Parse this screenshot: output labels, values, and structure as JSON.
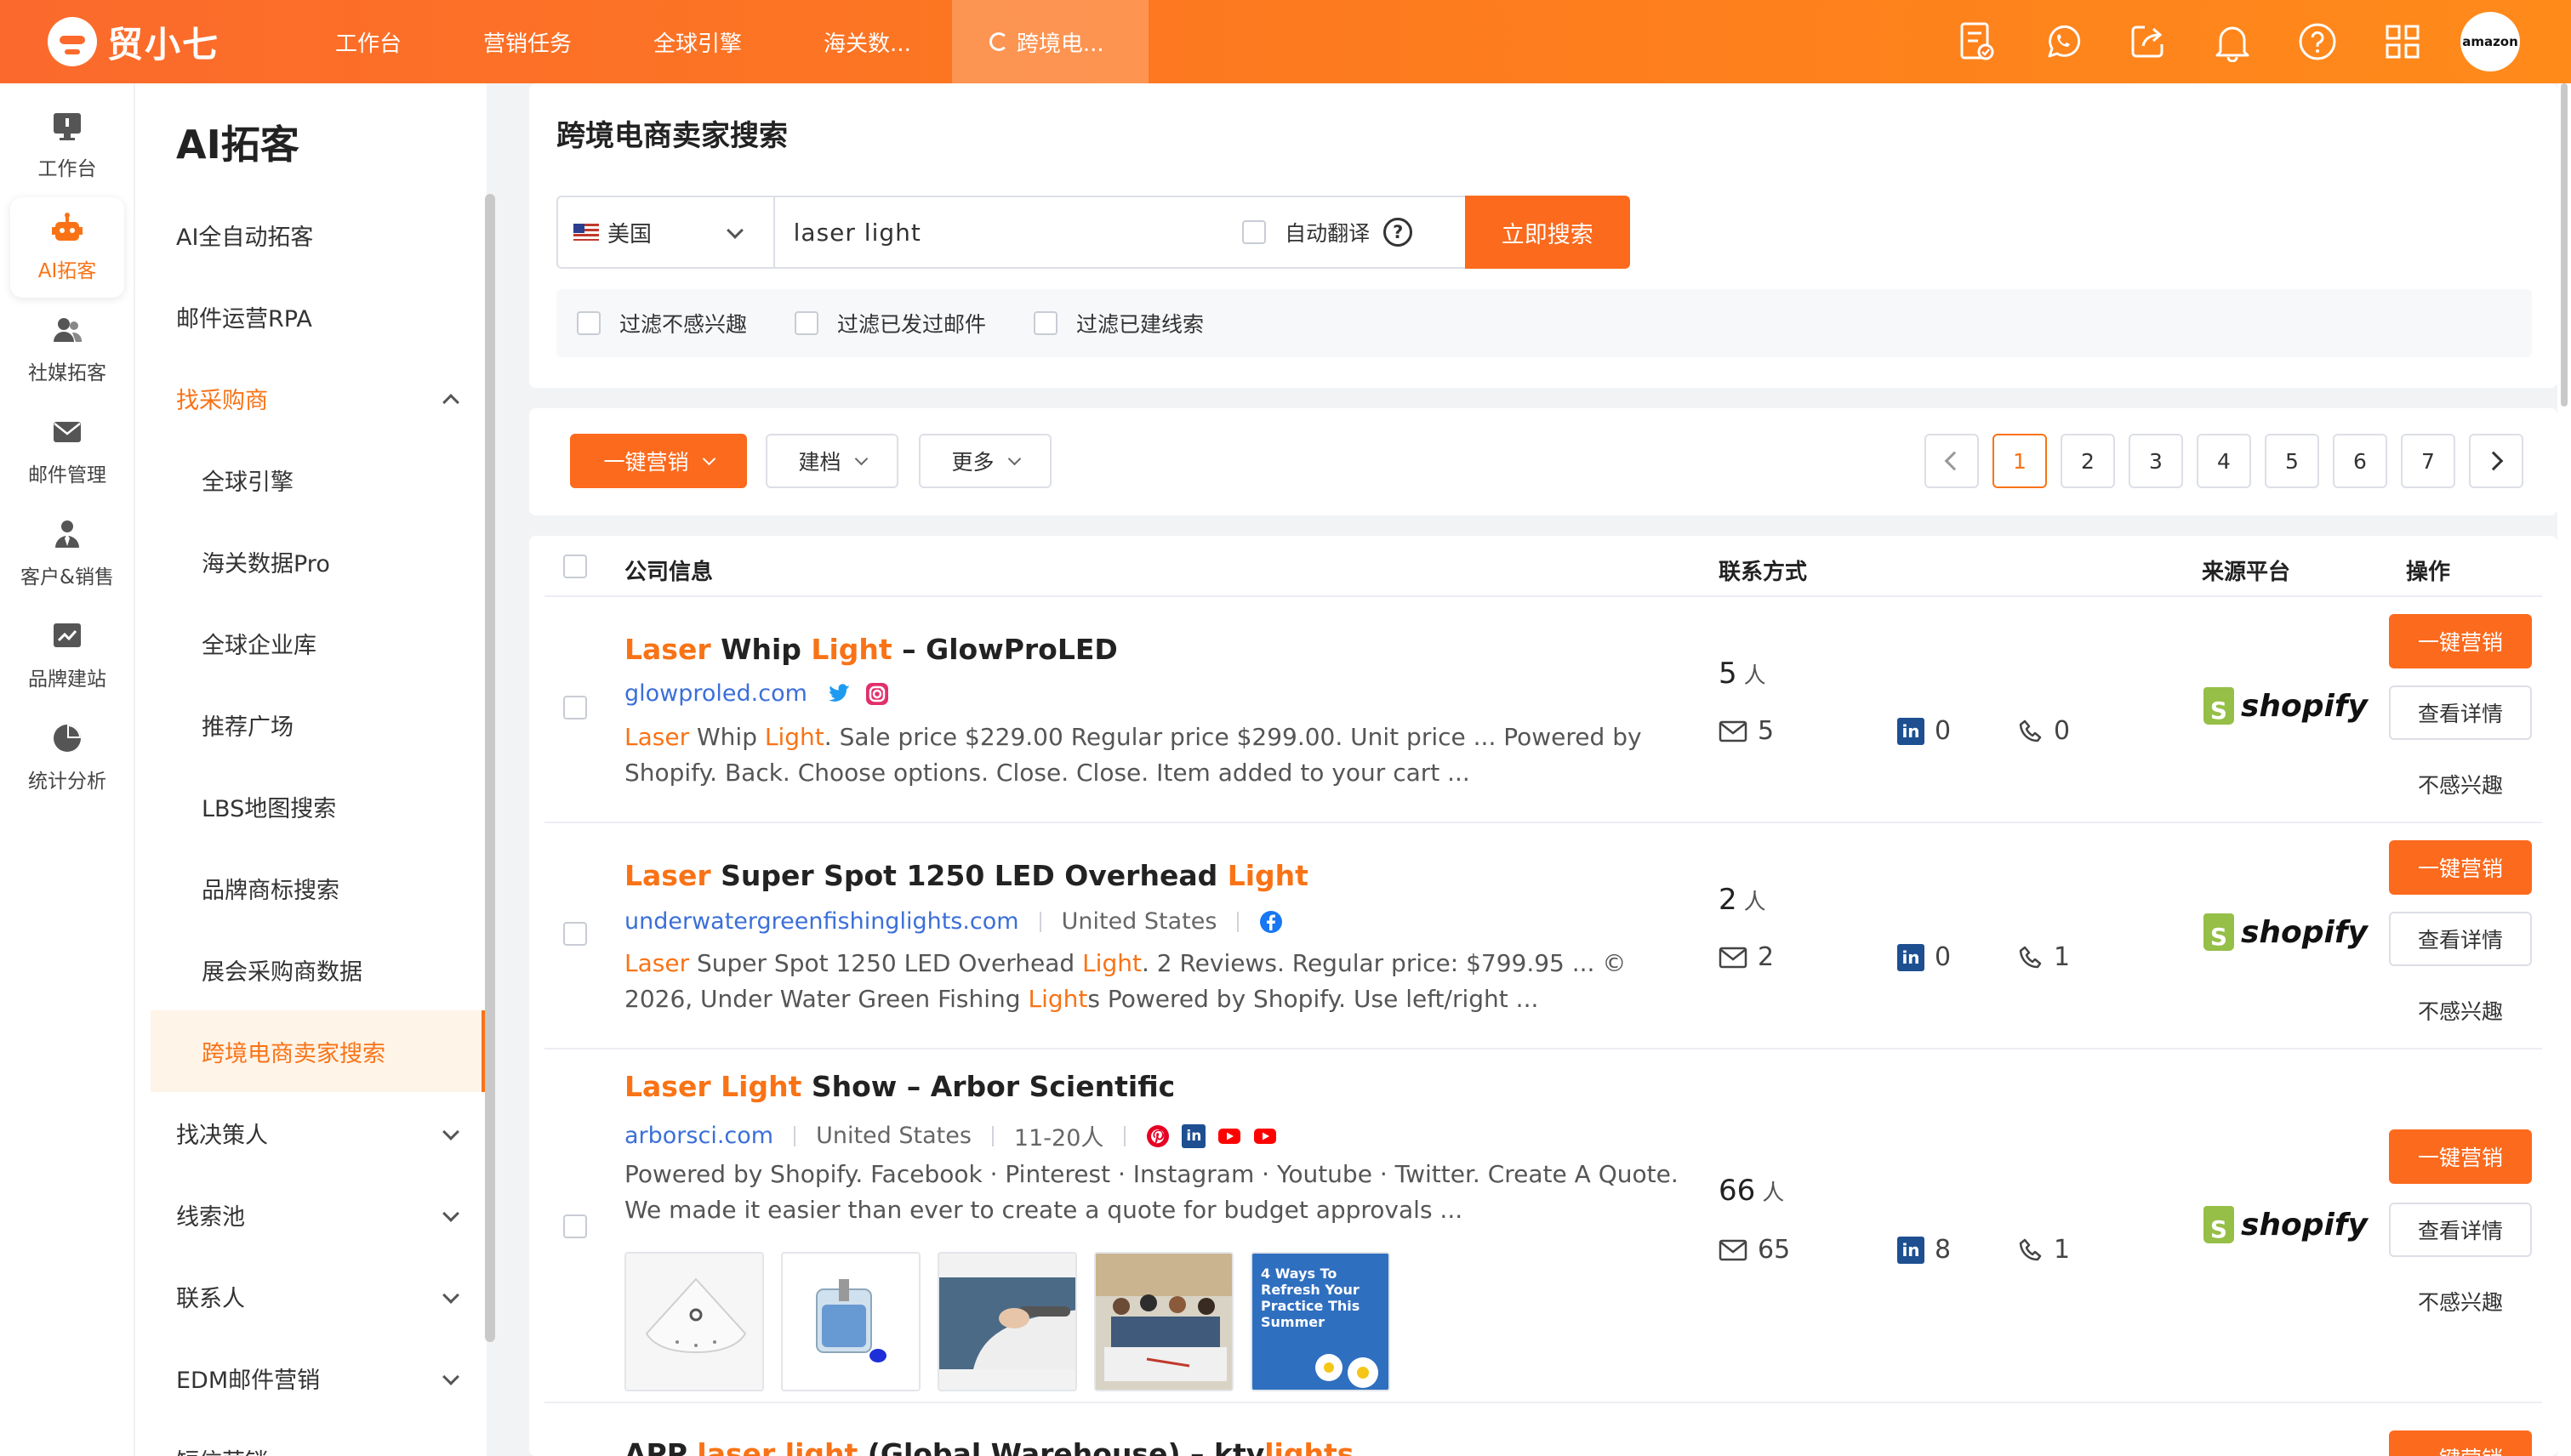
{
  "app": {
    "name": "贸小七"
  },
  "nav_tabs": [
    {
      "label": "工作台"
    },
    {
      "label": "营销任务"
    },
    {
      "label": "全球引擎"
    },
    {
      "label": "海关数..."
    },
    {
      "label": "跨境电..."
    }
  ],
  "top_icons": [
    "report-icon",
    "whatsapp-icon",
    "share-icon",
    "bell-icon",
    "help-icon",
    "apps-grid-icon"
  ],
  "top_badge": "amazon",
  "rail": [
    {
      "label": "工作台",
      "icon": "monitor-icon"
    },
    {
      "label": "AI拓客",
      "icon": "robot-icon"
    },
    {
      "label": "社媒拓客",
      "icon": "users-icon"
    },
    {
      "label": "邮件管理",
      "icon": "mail-icon"
    },
    {
      "label": "客户&销售",
      "icon": "person-icon"
    },
    {
      "label": "品牌建站",
      "icon": "chart-line-icon"
    },
    {
      "label": "统计分析",
      "icon": "pie-icon"
    }
  ],
  "menu": {
    "title": "AI拓客",
    "items": [
      {
        "label": "AI全自动拓客"
      },
      {
        "label": "邮件运营RPA"
      },
      {
        "label": "找采购商"
      },
      {
        "label": "全球引擎"
      },
      {
        "label": "海关数据Pro"
      },
      {
        "label": "全球企业库"
      },
      {
        "label": "推荐广场"
      },
      {
        "label": "LBS地图搜索"
      },
      {
        "label": "品牌商标搜索"
      },
      {
        "label": "展会采购商数据"
      },
      {
        "label": "跨境电商卖家搜索"
      },
      {
        "label": "找决策人"
      },
      {
        "label": "线索池"
      },
      {
        "label": "联系人"
      },
      {
        "label": "EDM邮件营销"
      },
      {
        "label": "短信营销"
      }
    ]
  },
  "search": {
    "title": "跨境电商卖家搜索",
    "country": "美国",
    "query": "laser light",
    "auto_translate": "自动翻译",
    "help": "?",
    "button": "立即搜索",
    "filters": [
      "过滤不感兴趣",
      "过滤已发过邮件",
      "过滤已建线索"
    ]
  },
  "toolbar": {
    "one_click": "一键营销",
    "archive": "建档",
    "more": "更多",
    "pages": [
      "1",
      "2",
      "3",
      "4",
      "5",
      "6",
      "7"
    ],
    "current_page": "1"
  },
  "table": {
    "headers": {
      "company": "公司信息",
      "contact": "联系方式",
      "source": "来源平台",
      "action": "操作"
    },
    "actions": {
      "market": "一键营销",
      "detail": "查看详情",
      "ignore": "不感兴趣"
    },
    "person_unit": "人",
    "platform": "shopify",
    "rows": [
      {
        "title": [
          "Laser",
          " Whip ",
          "Light",
          " – GlowProLED"
        ],
        "domain": "glowproled.com",
        "desc": [
          "Laser",
          " Whip ",
          "Light",
          ". Sale price $229.00 Regular price $299.00. Unit price ... Powered by Shopify. Back. Choose options. Close. Close. Item added to your cart ..."
        ],
        "people": "5",
        "emails": "5",
        "linkedin": "0",
        "phones": "0"
      },
      {
        "title": [
          "Laser",
          " Super Spot 1250 LED Overhead ",
          "Light"
        ],
        "domain": "underwatergreenfishinglights.com",
        "country": "United States",
        "desc": [
          "Laser",
          " Super Spot 1250 LED Overhead ",
          "Light",
          ". 2 Reviews. Regular price: $799.95 ... © 2026, Under Water Green Fishing ",
          "Light",
          "s Powered by Shopify. Use left/right ..."
        ],
        "people": "2",
        "emails": "2",
        "linkedin": "0",
        "phones": "1"
      },
      {
        "title": [
          "Laser",
          " ",
          "Light",
          " Show – Arbor Scientific"
        ],
        "domain": "arborsci.com",
        "country": "United States",
        "size": "11-20人",
        "desc": [
          "Powered by Shopify. Facebook · Pinterest · Instagram · Youtube · Twitter. Create A Quote. We made it easier than ever to create a quote for budget approvals ..."
        ],
        "thumb_text": "4 Ways To Refresh Your Practice This Summer",
        "people": "66",
        "emails": "65",
        "linkedin": "8",
        "phones": "1"
      },
      {
        "title": [
          "APP ",
          "laser light",
          " (Global Warehouse) – ktv",
          "lights"
        ]
      }
    ]
  }
}
